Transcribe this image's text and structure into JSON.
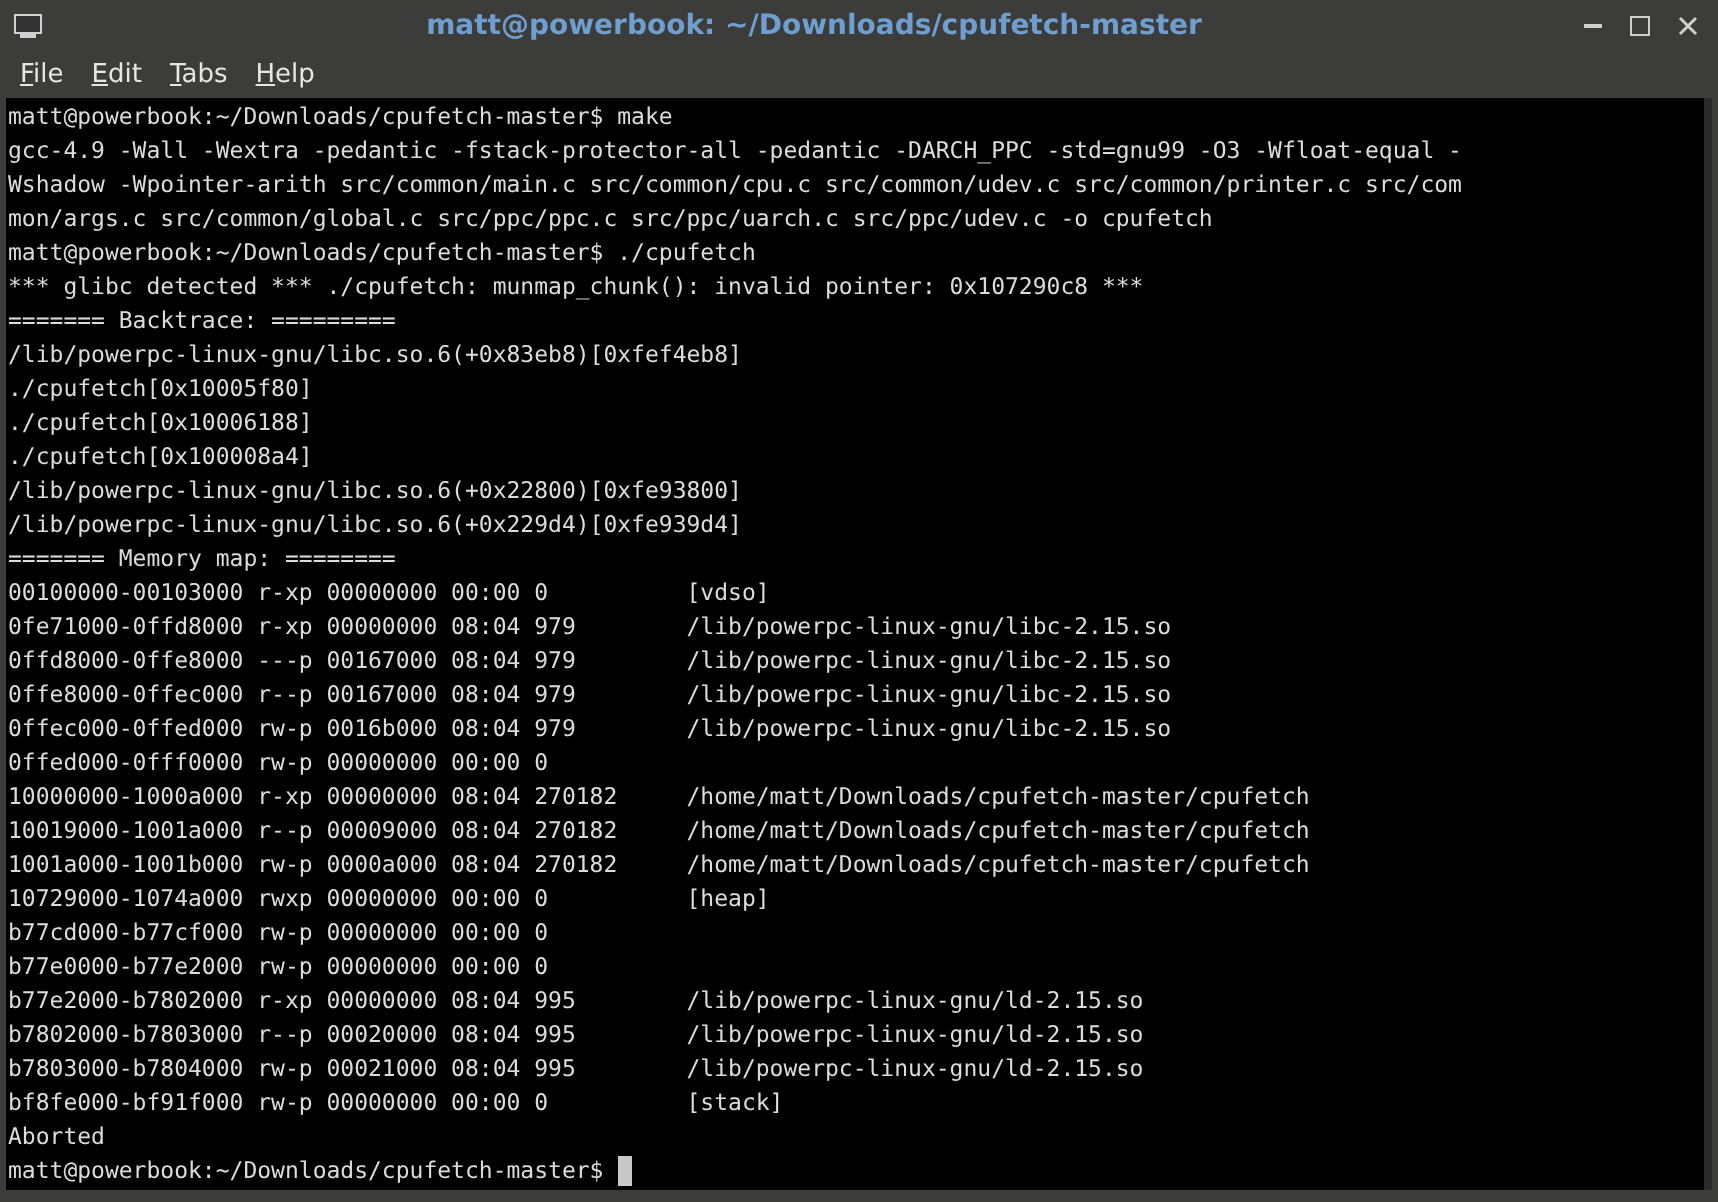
{
  "window": {
    "title": "matt@powerbook: ~/Downloads/cpufetch-master"
  },
  "menu": [
    {
      "label": "File",
      "underline_first": true
    },
    {
      "label": "Edit",
      "underline_first": true
    },
    {
      "label": "Tabs",
      "underline_first": true
    },
    {
      "label": "Help",
      "underline_first": true
    }
  ],
  "terminal": {
    "lines": [
      "matt@powerbook:~/Downloads/cpufetch-master$ make",
      "gcc-4.9 -Wall -Wextra -pedantic -fstack-protector-all -pedantic -DARCH_PPC -std=gnu99 -O3 -Wfloat-equal -",
      "Wshadow -Wpointer-arith src/common/main.c src/common/cpu.c src/common/udev.c src/common/printer.c src/com",
      "mon/args.c src/common/global.c src/ppc/ppc.c src/ppc/uarch.c src/ppc/udev.c -o cpufetch",
      "matt@powerbook:~/Downloads/cpufetch-master$ ./cpufetch",
      "*** glibc detected *** ./cpufetch: munmap_chunk(): invalid pointer: 0x107290c8 ***",
      "======= Backtrace: =========",
      "/lib/powerpc-linux-gnu/libc.so.6(+0x83eb8)[0xfef4eb8]",
      "./cpufetch[0x10005f80]",
      "./cpufetch[0x10006188]",
      "./cpufetch[0x100008a4]",
      "/lib/powerpc-linux-gnu/libc.so.6(+0x22800)[0xfe93800]",
      "/lib/powerpc-linux-gnu/libc.so.6(+0x229d4)[0xfe939d4]",
      "======= Memory map: ========",
      "00100000-00103000 r-xp 00000000 00:00 0          [vdso]",
      "0fe71000-0ffd8000 r-xp 00000000 08:04 979        /lib/powerpc-linux-gnu/libc-2.15.so",
      "0ffd8000-0ffe8000 ---p 00167000 08:04 979        /lib/powerpc-linux-gnu/libc-2.15.so",
      "0ffe8000-0ffec000 r--p 00167000 08:04 979        /lib/powerpc-linux-gnu/libc-2.15.so",
      "0ffec000-0ffed000 rw-p 0016b000 08:04 979        /lib/powerpc-linux-gnu/libc-2.15.so",
      "0ffed000-0fff0000 rw-p 00000000 00:00 0",
      "10000000-1000a000 r-xp 00000000 08:04 270182     /home/matt/Downloads/cpufetch-master/cpufetch",
      "10019000-1001a000 r--p 00009000 08:04 270182     /home/matt/Downloads/cpufetch-master/cpufetch",
      "1001a000-1001b000 rw-p 0000a000 08:04 270182     /home/matt/Downloads/cpufetch-master/cpufetch",
      "10729000-1074a000 rwxp 00000000 00:00 0          [heap]",
      "b77cd000-b77cf000 rw-p 00000000 00:00 0",
      "b77e0000-b77e2000 rw-p 00000000 00:00 0",
      "b77e2000-b7802000 r-xp 00000000 08:04 995        /lib/powerpc-linux-gnu/ld-2.15.so",
      "b7802000-b7803000 r--p 00020000 08:04 995        /lib/powerpc-linux-gnu/ld-2.15.so",
      "b7803000-b7804000 rw-p 00021000 08:04 995        /lib/powerpc-linux-gnu/ld-2.15.so",
      "bf8fe000-bf91f000 rw-p 00000000 00:00 0          [stack]",
      "Aborted",
      "matt@powerbook:~/Downloads/cpufetch-master$ "
    ],
    "cursor": true
  }
}
